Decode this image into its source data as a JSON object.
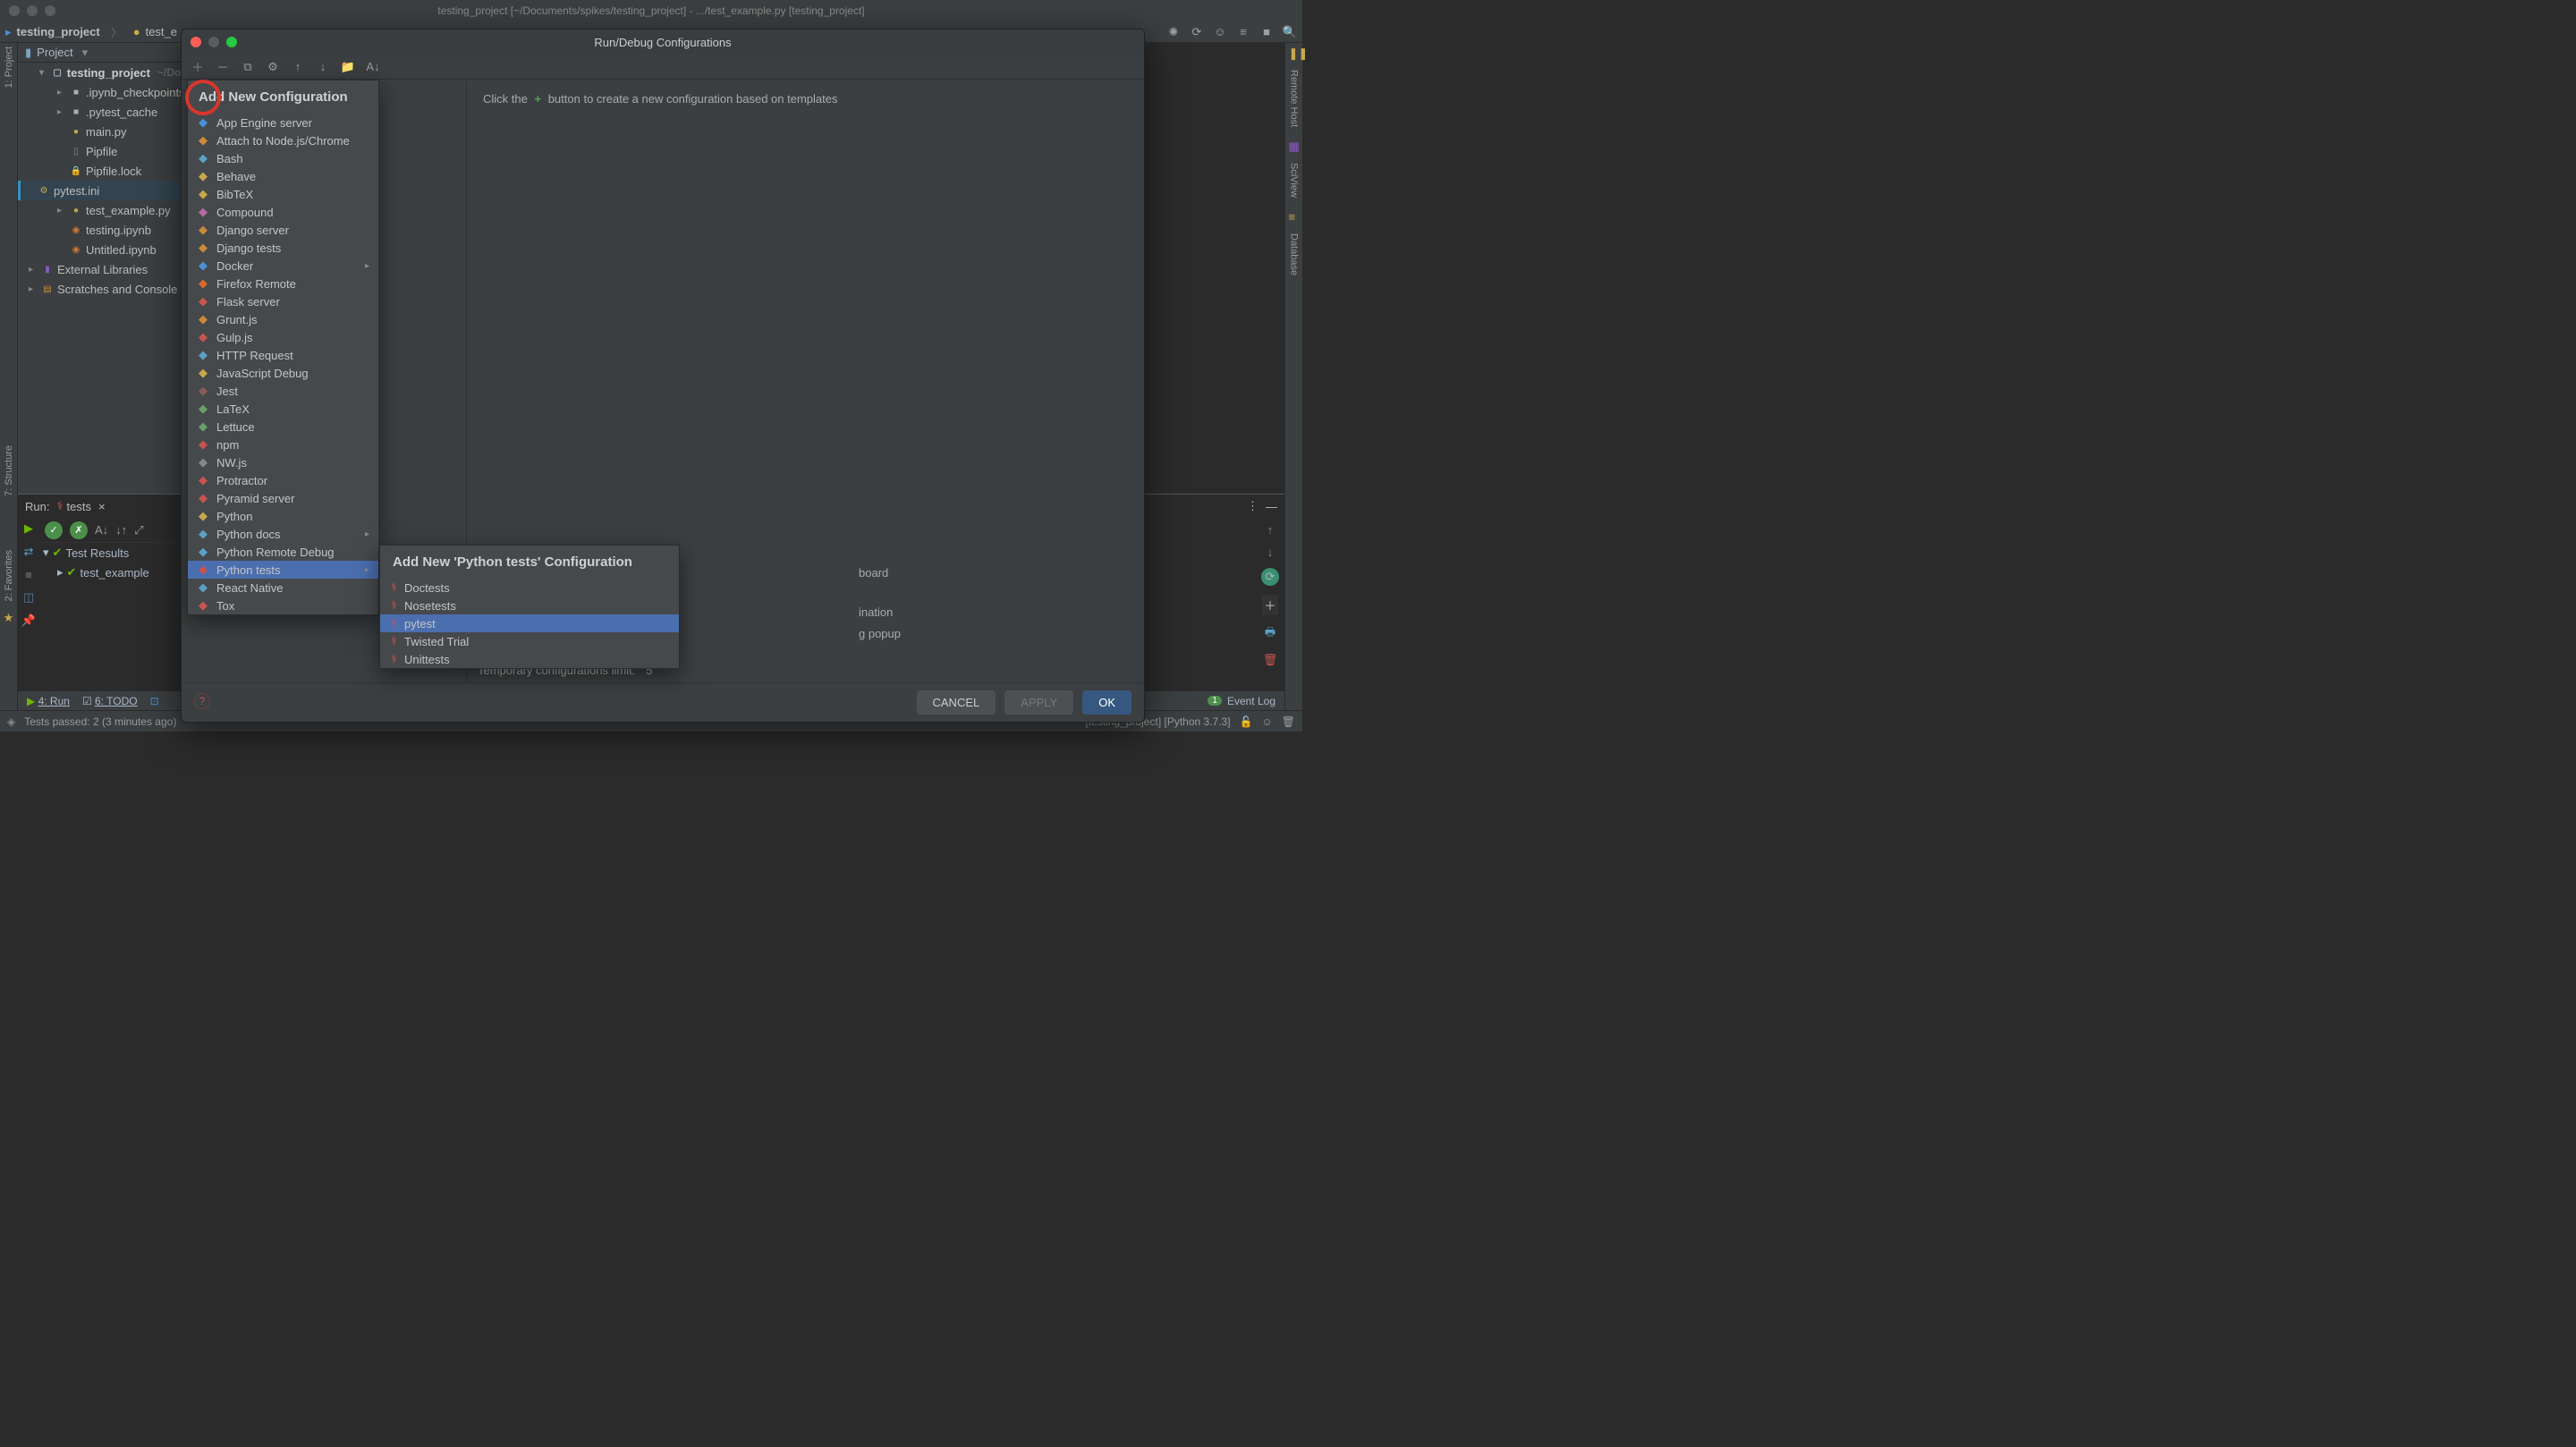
{
  "titlebar": "testing_project [~/Documents/spikes/testing_project] - .../test_example.py [testing_project]",
  "breadcrumb": {
    "project": "testing_project",
    "file": "test_e"
  },
  "project_header": "Project",
  "tree": {
    "root": "testing_project",
    "root_path": "~/Doc",
    "items": [
      {
        "label": ".ipynb_checkpoints",
        "icon": "folder",
        "chev": true
      },
      {
        "label": ".pytest_cache",
        "icon": "folder",
        "chev": true
      },
      {
        "label": "main.py",
        "icon": "python"
      },
      {
        "label": "Pipfile",
        "icon": "file"
      },
      {
        "label": "Pipfile.lock",
        "icon": "lock"
      },
      {
        "label": "pytest.ini",
        "icon": "ini",
        "selected": true
      },
      {
        "label": "test_example.py",
        "icon": "python",
        "chev": true
      },
      {
        "label": "testing.ipynb",
        "icon": "jupyter"
      },
      {
        "label": "Untitled.ipynb",
        "icon": "jupyter"
      }
    ],
    "external": "External Libraries",
    "scratches": "Scratches and Console"
  },
  "run_panel": {
    "label": "Run:",
    "config": "tests",
    "test_results": "Test Results",
    "test_example": "test_example"
  },
  "status": {
    "run": "4: Run",
    "todo": "6: TODO",
    "passed": "Tests passed: 2 (3 minutes ago)",
    "event_log": "Event Log",
    "event_count": "1",
    "interpreter": "[testing_project] [Python 3.7.3]"
  },
  "left_rail": {
    "project": "1: Project",
    "structure": "7: Structure",
    "favorites": "2: Favorites"
  },
  "right_rail": {
    "remote": "Remote Host",
    "sciview": "SciView",
    "database": "Database"
  },
  "modal": {
    "title": "Run/Debug Configurations",
    "hint_pre": "Click the",
    "hint_post": "button to create a new configuration based on templates",
    "footer": {
      "cancel": "CANCEL",
      "apply": "APPLY",
      "ok": "OK"
    },
    "temp_label": "Temporary configurations limit:",
    "temp_value": "5",
    "behind1": "board",
    "behind2": "ination",
    "behind3": "g popup"
  },
  "cfg_popup": {
    "title": "Add New Configuration",
    "items": [
      {
        "label": "App Engine server",
        "color": "#4a90d9"
      },
      {
        "label": "Attach to Node.js/Chrome",
        "color": "#d08a3a"
      },
      {
        "label": "Bash",
        "color": "#5aa0c8"
      },
      {
        "label": "Behave",
        "color": "#c9a84b"
      },
      {
        "label": "BibTeX",
        "color": "#c9a84b"
      },
      {
        "label": "Compound",
        "color": "#b86aa0"
      },
      {
        "label": "Django server",
        "color": "#c98a3a"
      },
      {
        "label": "Django tests",
        "color": "#c98a3a"
      },
      {
        "label": "Docker",
        "color": "#4a90d9",
        "arrow": true
      },
      {
        "label": "Firefox Remote",
        "color": "#d96a2a"
      },
      {
        "label": "Flask server",
        "color": "#c75450"
      },
      {
        "label": "Grunt.js",
        "color": "#c98a3a"
      },
      {
        "label": "Gulp.js",
        "color": "#c75450"
      },
      {
        "label": "HTTP Request",
        "color": "#5aa0c8"
      },
      {
        "label": "JavaScript Debug",
        "color": "#c9a84b"
      },
      {
        "label": "Jest",
        "color": "#8a5a5a"
      },
      {
        "label": "LaTeX",
        "color": "#6aa06a"
      },
      {
        "label": "Lettuce",
        "color": "#6aa06a"
      },
      {
        "label": "npm",
        "color": "#c75450"
      },
      {
        "label": "NW.js",
        "color": "#888"
      },
      {
        "label": "Protractor",
        "color": "#c75450"
      },
      {
        "label": "Pyramid server",
        "color": "#c75450"
      },
      {
        "label": "Python",
        "color": "#c9a84b"
      },
      {
        "label": "Python docs",
        "color": "#5aa0c8",
        "arrow": true
      },
      {
        "label": "Python Remote Debug",
        "color": "#5aa0c8"
      },
      {
        "label": "Python tests",
        "color": "#c75450",
        "arrow": true,
        "hover": true
      },
      {
        "label": "React Native",
        "color": "#5aa0c8"
      },
      {
        "label": "Tox",
        "color": "#c75450"
      }
    ]
  },
  "sub_popup": {
    "title": "Add New 'Python tests' Configuration",
    "items": [
      {
        "label": "Doctests"
      },
      {
        "label": "Nosetests"
      },
      {
        "label": "pytest",
        "sel": true
      },
      {
        "label": "Twisted Trial"
      },
      {
        "label": "Unittests"
      }
    ]
  }
}
